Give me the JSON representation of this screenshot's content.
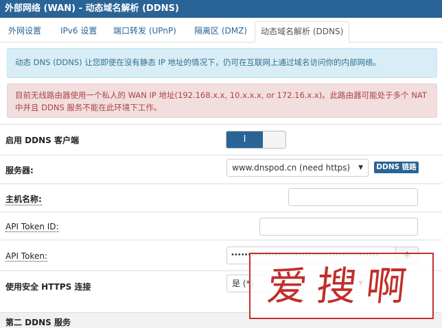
{
  "header": {
    "title": "外部网络 (WAN) - 动态域名解析 (DDNS)"
  },
  "tabs": [
    {
      "label": "外网设置",
      "active": false
    },
    {
      "label": "IPv6 设置",
      "active": false
    },
    {
      "label": "端口转发 (UPnP)",
      "active": false
    },
    {
      "label": "隔离区 (DMZ)",
      "active": false
    },
    {
      "label": "动态域名解析 (DDNS)",
      "active": true
    }
  ],
  "alerts": {
    "info": "动态 DNS (DDNS) 让您即使在没有静态 IP 地址的情况下，仍可在互联网上通过域名访问你的内部网络。",
    "warning": "目前无线路由器使用一个私人的 WAN IP 地址(192.168.x.x, 10.x.x.x, or 172.16.x.x)。此路由器可能处于多个 NAT 中并且 DDNS 服务不能在此环境下工作。"
  },
  "form": {
    "enable_label": "启用 DDNS 客户端",
    "enable_value": "I",
    "server_label": "服务器:",
    "server_value": "www.dnspod.cn (need https)",
    "server_link": "DDNS 链路",
    "hostname_label": "主机名称:",
    "hostname_value": "",
    "token_id_label": "API Token ID:",
    "token_id_value": "",
    "token_label": "API Token:",
    "token_value": "••••••••••••••••••••••••••••••••••••••••••••",
    "https_label": "使用安全 HTTPS 连接",
    "https_value": "是 (*)"
  },
  "section2": {
    "title": "第二 DDNS 服务"
  },
  "watermark": {
    "text": "爱搜啊"
  },
  "colors": {
    "primary": "#2a6496",
    "watermark": "#c12e2a",
    "info_bg": "#d9edf7",
    "danger_bg": "#f2dede"
  }
}
